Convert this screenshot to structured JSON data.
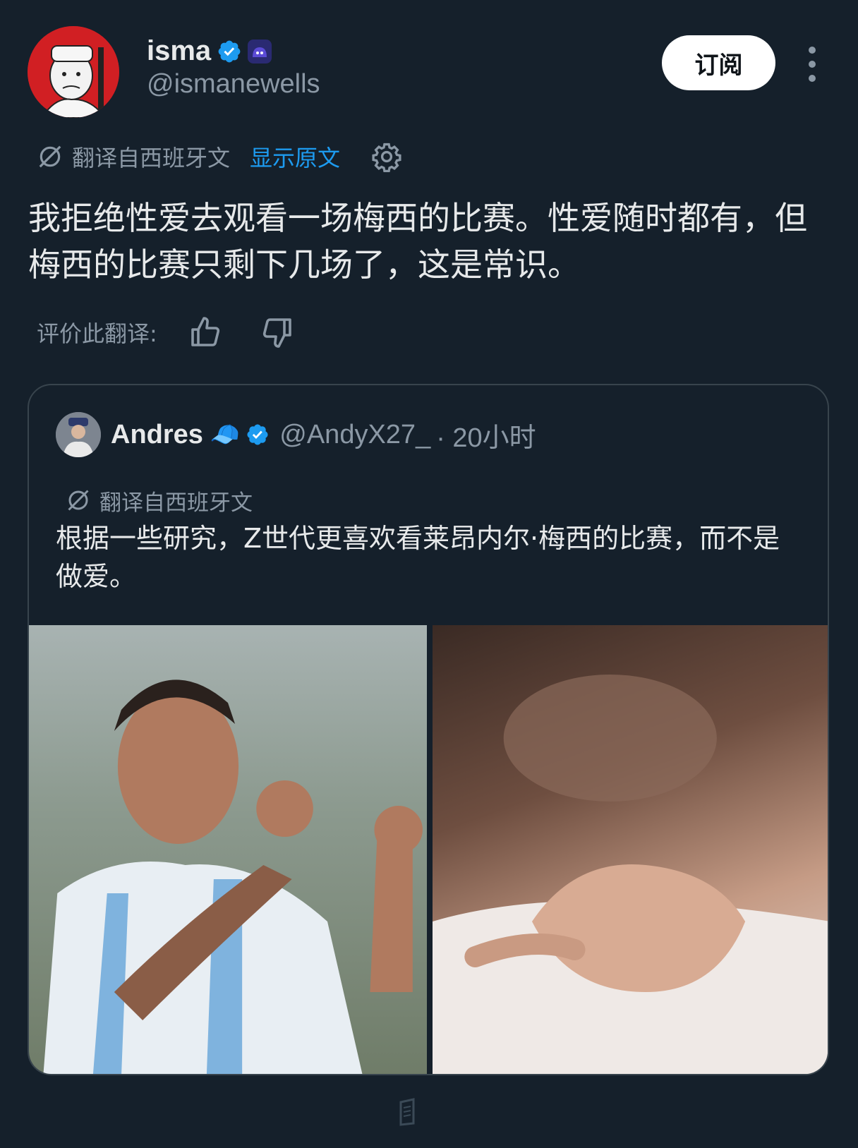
{
  "author": {
    "display_name": "isma",
    "handle": "@ismanewells"
  },
  "header": {
    "subscribe_label": "订阅"
  },
  "translation": {
    "label": "翻译自西班牙文",
    "show_original": "显示原文"
  },
  "tweet": {
    "text": "我拒绝性爱去观看一场梅西的比赛。性爱随时都有，但梅西的比赛只剩下几场了，这是常识。"
  },
  "rating": {
    "label": "评价此翻译:"
  },
  "quote": {
    "display_name": "Andres",
    "emoji": "🧢",
    "handle": "@AndyX27_",
    "time": "· 20小时",
    "translation_label": "翻译自西班牙文",
    "text": "根据一些研究，Z世代更喜欢看莱昂内尔·梅西的比赛，而不是做爱。"
  },
  "colors": {
    "background": "#15202b",
    "primary_text": "#e7e9ea",
    "secondary_text": "#8b98a5",
    "link": "#1d9bf0",
    "verified": "#1d9bf0",
    "border": "#38444d"
  },
  "icons": {
    "verified": "verified-badge-icon",
    "affiliate": "affiliate-badge-icon",
    "translate": "translate-icon",
    "settings": "gear-icon",
    "like": "thumbs-up-icon",
    "dislike": "thumbs-down-icon",
    "more": "more-vertical-icon"
  }
}
